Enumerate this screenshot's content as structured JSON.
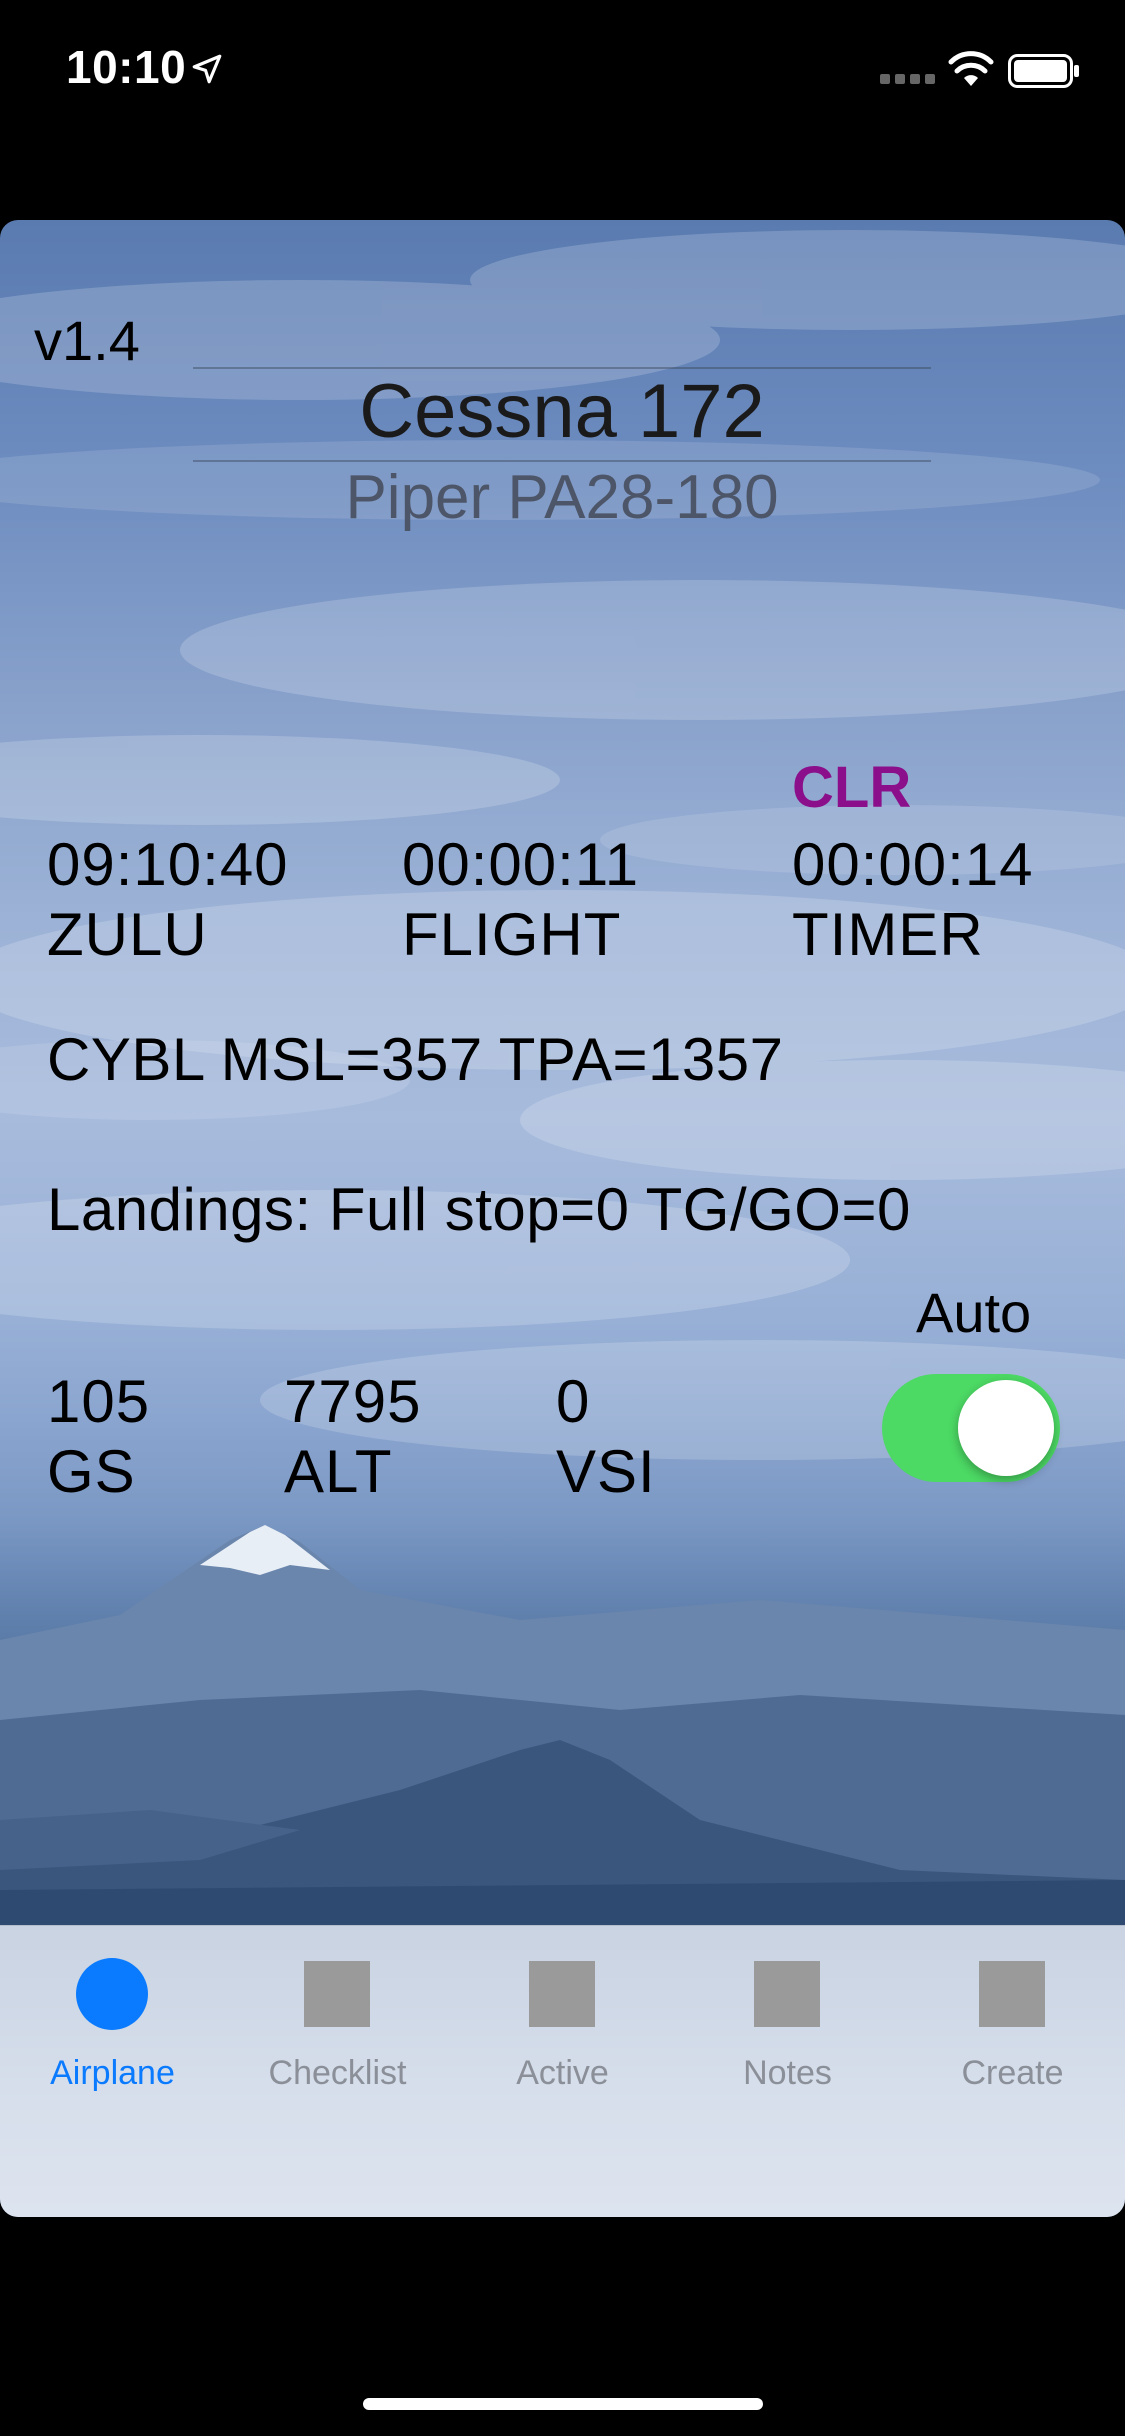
{
  "status_bar": {
    "time": "10:10",
    "icons": [
      "location-arrow-icon",
      "cellular-signal-icon",
      "wifi-icon",
      "battery-icon"
    ]
  },
  "header": {
    "version": "v1.4",
    "aircraft_picker": {
      "selected": "Cessna 172",
      "next": "Piper PA28-180"
    }
  },
  "timers": {
    "clear_label": "CLR",
    "zulu": {
      "value": "09:10:40",
      "label": "ZULU"
    },
    "flight": {
      "value": "00:00:11",
      "label": "FLIGHT"
    },
    "timer": {
      "value": "00:00:14",
      "label": "TIMER"
    }
  },
  "airport_info": "CYBL MSL=357  TPA=1357",
  "landings": "Landings: Full stop=0 TG/GO=0",
  "instruments": {
    "gs": {
      "value": "105",
      "label": "GS"
    },
    "alt": {
      "value": "7795",
      "label": "ALT"
    },
    "vsi": {
      "value": "0",
      "label": "VSI"
    }
  },
  "auto_toggle": {
    "label": "Auto",
    "on": true,
    "on_color": "#4cd964"
  },
  "tab_bar": {
    "active_color": "#0a7afe",
    "tabs": [
      {
        "label": "Airplane",
        "active": true
      },
      {
        "label": "Checklist",
        "active": false
      },
      {
        "label": "Active",
        "active": false
      },
      {
        "label": "Notes",
        "active": false
      },
      {
        "label": "Create",
        "active": false
      }
    ]
  }
}
